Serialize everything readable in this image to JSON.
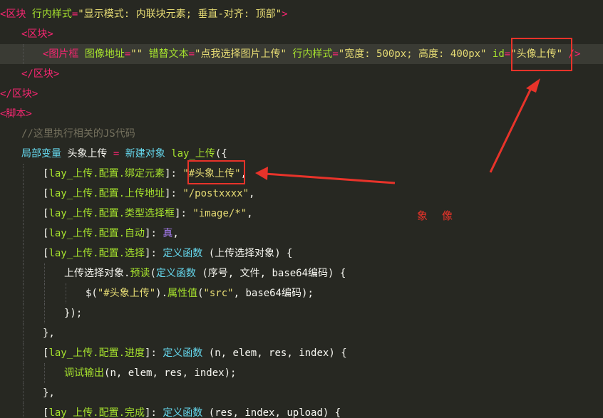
{
  "lines": [
    {
      "indent": 0,
      "tokens": [
        [
          "tag",
          "<区块 "
        ],
        [
          "attr",
          "行内样式"
        ],
        [
          "op",
          "="
        ],
        [
          "str",
          "\"显示模式: 内联块元素; 垂直-对齐: 顶部\""
        ],
        [
          "tag",
          ">"
        ]
      ]
    },
    {
      "indent": 1,
      "tokens": [
        [
          "tag",
          "<区块>"
        ]
      ]
    },
    {
      "indent": 2,
      "active": true,
      "tokens": [
        [
          "tag",
          "<图片框 "
        ],
        [
          "attr",
          "图像地址"
        ],
        [
          "op",
          "="
        ],
        [
          "str",
          "\"\" "
        ],
        [
          "attr",
          "错替文本"
        ],
        [
          "op",
          "="
        ],
        [
          "str",
          "\"点我选择图片上传\" "
        ],
        [
          "attr",
          "行内样式"
        ],
        [
          "op",
          "="
        ],
        [
          "str",
          "\"宽度: 500px; 高度: 400px\" "
        ],
        [
          "attr",
          "id"
        ],
        [
          "op",
          "="
        ],
        [
          "str",
          "\"头像上传\""
        ],
        [
          "plain",
          " "
        ],
        [
          "tag",
          "/>"
        ]
      ]
    },
    {
      "indent": 1,
      "tokens": [
        [
          "tag",
          "</区块>"
        ]
      ]
    },
    {
      "indent": 0,
      "tokens": [
        [
          "tag",
          "</区块>"
        ]
      ]
    },
    {
      "indent": 0,
      "tokens": [
        [
          "tag",
          "<脚本>"
        ]
      ]
    },
    {
      "indent": 1,
      "tokens": [
        [
          "comment",
          "//这里执行相关的JS代码"
        ]
      ]
    },
    {
      "indent": 1,
      "tokens": [
        [
          "fn",
          "局部变量 "
        ],
        [
          "plain",
          "头象上传 "
        ],
        [
          "op",
          "= "
        ],
        [
          "fn",
          "新建对象 "
        ],
        [
          "var",
          "lay_上传"
        ],
        [
          "punct",
          "({"
        ]
      ]
    },
    {
      "indent": 2,
      "tokens": [
        [
          "punct",
          "["
        ],
        [
          "var",
          "lay_上传.配置.绑定元素"
        ],
        [
          "punct",
          "]: "
        ],
        [
          "str",
          "\"#头象上传\""
        ],
        [
          "punct",
          ","
        ]
      ]
    },
    {
      "indent": 2,
      "tokens": [
        [
          "punct",
          "["
        ],
        [
          "var",
          "lay_上传.配置.上传地址"
        ],
        [
          "punct",
          "]: "
        ],
        [
          "str",
          "\"/postxxxx\""
        ],
        [
          "punct",
          ","
        ]
      ]
    },
    {
      "indent": 2,
      "tokens": [
        [
          "punct",
          "["
        ],
        [
          "var",
          "lay_上传.配置.类型选择框"
        ],
        [
          "punct",
          "]: "
        ],
        [
          "str",
          "\"image/*\""
        ],
        [
          "punct",
          ","
        ]
      ]
    },
    {
      "indent": 2,
      "tokens": [
        [
          "punct",
          "["
        ],
        [
          "var",
          "lay_上传.配置.自动"
        ],
        [
          "punct",
          "]: "
        ],
        [
          "bool",
          "真"
        ],
        [
          "punct",
          ","
        ]
      ]
    },
    {
      "indent": 2,
      "tokens": [
        [
          "punct",
          "["
        ],
        [
          "var",
          "lay_上传.配置.选择"
        ],
        [
          "punct",
          "]: "
        ],
        [
          "fn",
          "定义函数 "
        ],
        [
          "punct",
          "("
        ],
        [
          "plain",
          "上传选择对象"
        ],
        [
          "punct",
          ") {"
        ]
      ]
    },
    {
      "indent": 3,
      "tokens": [
        [
          "plain",
          "上传选择对象."
        ],
        [
          "var",
          "预读"
        ],
        [
          "punct",
          "("
        ],
        [
          "fn",
          "定义函数 "
        ],
        [
          "punct",
          "("
        ],
        [
          "plain",
          "序号, 文件, base64编码"
        ],
        [
          "punct",
          ") {"
        ]
      ]
    },
    {
      "indent": 4,
      "tokens": [
        [
          "plain",
          "$("
        ],
        [
          "str",
          "\"#头象上传\""
        ],
        [
          "plain",
          ")."
        ],
        [
          "var",
          "属性值"
        ],
        [
          "punct",
          "("
        ],
        [
          "str",
          "\"src\""
        ],
        [
          "punct",
          ", "
        ],
        [
          "plain",
          "base64编码"
        ],
        [
          "punct",
          ");"
        ]
      ]
    },
    {
      "indent": 3,
      "tokens": [
        [
          "punct",
          "});"
        ]
      ]
    },
    {
      "indent": 2,
      "tokens": [
        [
          "punct",
          "},"
        ]
      ]
    },
    {
      "indent": 2,
      "tokens": [
        [
          "punct",
          "["
        ],
        [
          "var",
          "lay_上传.配置.进度"
        ],
        [
          "punct",
          "]: "
        ],
        [
          "fn",
          "定义函数 "
        ],
        [
          "punct",
          "("
        ],
        [
          "plain",
          "n, elem, res, index"
        ],
        [
          "punct",
          ") {"
        ]
      ]
    },
    {
      "indent": 3,
      "tokens": [
        [
          "var",
          "调试输出"
        ],
        [
          "punct",
          "("
        ],
        [
          "plain",
          "n, elem, res, index"
        ],
        [
          "punct",
          ");"
        ]
      ]
    },
    {
      "indent": 2,
      "tokens": [
        [
          "punct",
          "},"
        ]
      ]
    },
    {
      "indent": 2,
      "tokens": [
        [
          "punct",
          "["
        ],
        [
          "var",
          "lay_上传.配置.完成"
        ],
        [
          "punct",
          "]: "
        ],
        [
          "fn",
          "定义函数 "
        ],
        [
          "punct",
          "("
        ],
        [
          "plain",
          "res, index, upload"
        ],
        [
          "punct",
          ") {"
        ]
      ]
    }
  ],
  "annotation": {
    "text": "象像"
  },
  "colors": {
    "highlight": "#e8332a",
    "background": "#272822"
  }
}
